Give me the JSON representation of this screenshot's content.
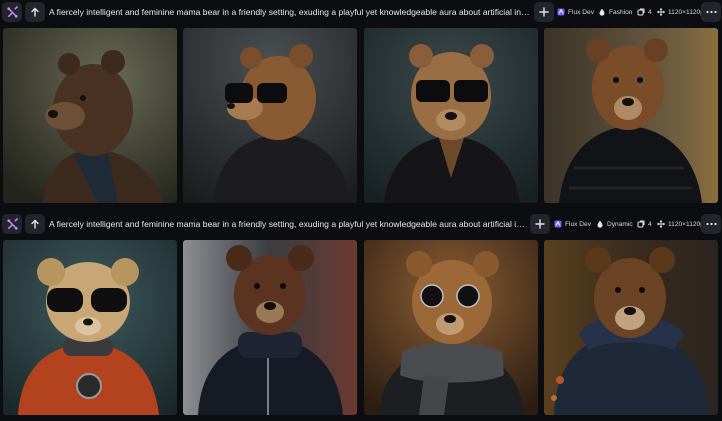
{
  "generations": [
    {
      "prompt": "A fiercely intelligent and feminine mama bear in a friendly setting, exuding a playful yet knowledgeable aura about artificial intelligence. This",
      "model": "Flux Dev",
      "style": "Fashion",
      "count": "4",
      "size": "1120×1120px",
      "images": [
        {
          "name": "bear-brown-leather-jacket"
        },
        {
          "name": "bear-sunglasses-black-jacket"
        },
        {
          "name": "bear-sunglasses-black-coat"
        },
        {
          "name": "bear-black-puffer-jacket"
        }
      ]
    },
    {
      "prompt": "A fiercely intelligent and feminine mama bear in a friendly setting, exuding a playful yet knowledgeable aura about artificial intelligence.",
      "model": "Flux Dev",
      "style": "Dynamic",
      "count": "4",
      "size": "1120×1120px",
      "images": [
        {
          "name": "bear-sunglasses-orange-jacket"
        },
        {
          "name": "bear-navy-puffer-jacket"
        },
        {
          "name": "bear-sunglasses-knit-scarf"
        },
        {
          "name": "bear-navy-hooded-jacket"
        }
      ]
    }
  ],
  "icons": {
    "flow": "flow-icon",
    "upscale": "arrow-up-icon",
    "add": "plus-icon",
    "model": "flux-icon",
    "style": "style-drop-icon",
    "count": "images-stack-icon",
    "size": "resize-arrows-icon",
    "more": "more-dots-icon"
  },
  "colors": {
    "background": "#0c0d10",
    "button": "#23252c",
    "accent": "#b07cf7"
  }
}
